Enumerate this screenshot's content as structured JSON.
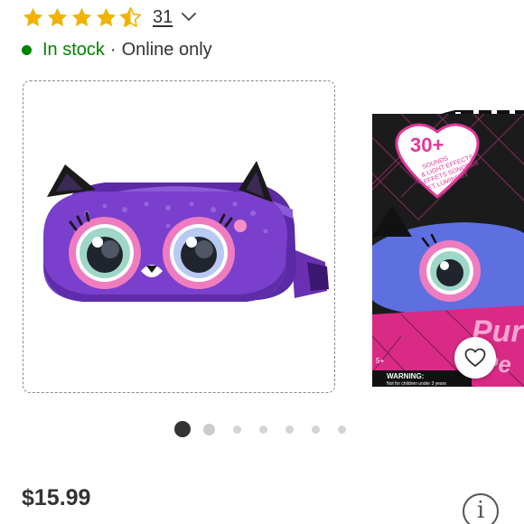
{
  "rating": {
    "value": 4.5,
    "max": 5,
    "review_count": "31",
    "star_color": "#f2b300"
  },
  "stock": {
    "status": "In stock",
    "separator": "·",
    "note": "Online only",
    "status_color": "#008300"
  },
  "carousel": {
    "slide_count": 7,
    "active_index": 0,
    "fav_icon": "heart-outline-icon"
  },
  "product_image": {
    "subject": "purple cat fanny pack"
  },
  "next_image": {
    "badge_big": "30+",
    "badge_text": "SOUNDS & LIGHT EFFECTS EFFETS SONORES ET LUMINEUX",
    "brand_partial": "Pur",
    "brand_partial_2": "Pe",
    "age_mark": "5+",
    "warning_title": "WARNING:",
    "warning_small": "Not for children under 3 years"
  },
  "price": "$15.99",
  "info_icon": "info-icon",
  "info_glyph": "i"
}
